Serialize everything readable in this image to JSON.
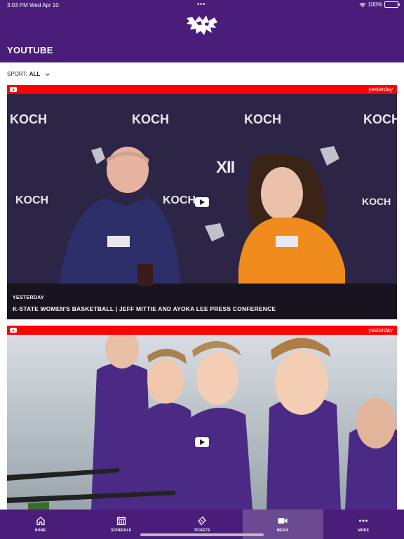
{
  "status_bar": {
    "time": "3:03 PM",
    "date": "Wed Apr 10",
    "battery": "100%"
  },
  "header": {
    "title": "YOUTUBE",
    "logo": "wildcat-logo"
  },
  "filter": {
    "label": "SPORT:",
    "value": "ALL"
  },
  "videos": [
    {
      "badge": "yesterday",
      "date_label": "YESTERDAY",
      "title": "K-STATE WOMEN'S BASKETBALL | JEFF MITTIE AND AYOKA LEE PRESS CONFERENCE",
      "backdrop_text": [
        "KOCH",
        "KOCH",
        "KOCH",
        "KOCH",
        "KOCH",
        "KOCH",
        "KOCH"
      ],
      "conference_logo": "XII"
    },
    {
      "badge": "yesterday"
    }
  ],
  "tabs": [
    {
      "label": "HOME",
      "icon": "home-icon",
      "active": false
    },
    {
      "label": "SCHEDULE",
      "icon": "calendar-icon",
      "active": false
    },
    {
      "label": "TICKETS",
      "icon": "ticket-icon",
      "active": false
    },
    {
      "label": "MEDIA",
      "icon": "video-camera-icon",
      "active": true
    },
    {
      "label": "MORE",
      "icon": "more-dots-icon",
      "active": false
    }
  ],
  "colors": {
    "brand_purple": "#4a1d7a",
    "active_tab": "#6b4a92",
    "youtube_red": "#ff0000"
  }
}
